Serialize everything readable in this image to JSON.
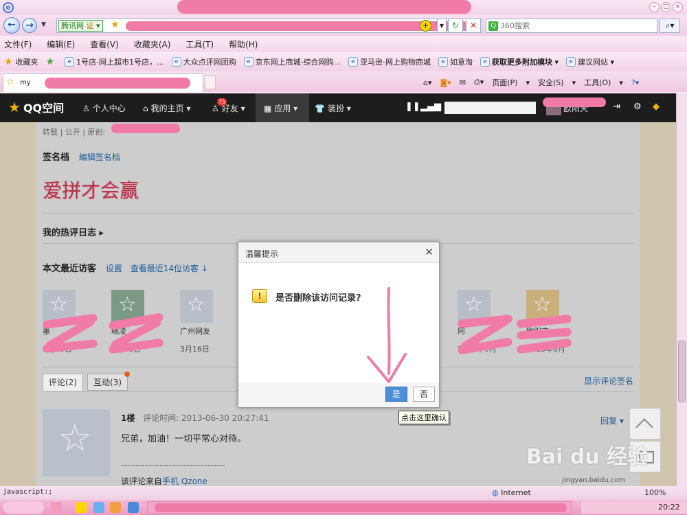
{
  "search": {
    "placeholder": "360搜索"
  },
  "address": {
    "site_badge": "腾讯网",
    "verified": "证"
  },
  "menu": [
    "文件(F)",
    "编辑(E)",
    "查看(V)",
    "收藏夹(A)",
    "工具(T)",
    "帮助(H)"
  ],
  "favorites": {
    "label": "收藏夹",
    "items": [
      "1号店-网上超市1号店，...",
      "大众点评网团购",
      "京东网上商城-综合网购...",
      "亚马逊-网上购物商城",
      "如意淘",
      "获取更多附加模块",
      "建议网站"
    ]
  },
  "tab": {
    "title": "my"
  },
  "commandbar": {
    "page": "页面(P)",
    "safety": "安全(S)",
    "tools": "工具(O)"
  },
  "qzone": {
    "logo": "QQ空间",
    "nav": {
      "profile": "个人中心",
      "home": "我的主页",
      "friends": "好友",
      "apps": "应用",
      "decorate": "装扮"
    },
    "friends_badge": "75",
    "nickname": "欧阳天"
  },
  "article": {
    "meta": "转载 | 公开 | 原创:",
    "signature_title": "签名档",
    "signature_edit": "编辑签名档",
    "signature_text": "爱拼才会赢",
    "hot_logs": "我的热评日志",
    "visitors_title": "本文最近访客",
    "visitors_settings": "设置",
    "visitors_more": "查看最近14位访客",
    "visitors": [
      {
        "name": "墨",
        "date": "5月25日"
      },
      {
        "name": "晓凌",
        "date": "3月18日"
      },
      {
        "name": "广州网友",
        "date": "3月16日"
      },
      {
        "name": "阿",
        "date": "2013年9月"
      },
      {
        "name": "欧阳吉",
        "date": "2013年8月"
      }
    ],
    "tab_comments": "评论(2)",
    "tab_interact": "互动(3)",
    "show_sign": "显示评论签名",
    "comment": {
      "floor": "1楼",
      "time": "评论时间: 2013-06-30 20:27:41",
      "reply": "回复",
      "text": "兄弟，加油！一切平常心对待。",
      "divider": "-----------------------------------",
      "source_prefix": "该评论来自",
      "source_link": "手机 Qzone"
    }
  },
  "dialog": {
    "title": "温馨提示",
    "message": "是否删除该访问记录?",
    "yes": "是",
    "no": "否"
  },
  "tooltip": "点击这里确认",
  "watermark": {
    "brand": "Bai du 经验",
    "url": "jingyan.baidu.com"
  },
  "statusbar": {
    "left": "javascript:;",
    "zone": "Internet",
    "zoom": "100%"
  },
  "taskbar": {
    "clock": "20:22"
  }
}
